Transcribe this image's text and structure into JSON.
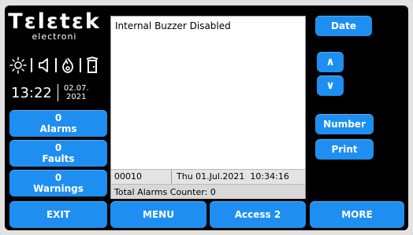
{
  "logo": {
    "name": "Tεlεtεk",
    "sub": "electroni"
  },
  "status_icons": [
    "sun-icon",
    "speaker-icon",
    "fire-icon",
    "door-icon"
  ],
  "clock": {
    "time": "13:22",
    "date_line1": "02.07.",
    "date_line2": "2021"
  },
  "left_buttons": [
    {
      "count": "0",
      "label": "Alarms"
    },
    {
      "count": "0",
      "label": "Faults"
    },
    {
      "count": "0",
      "label": "Warnings"
    }
  ],
  "screen": {
    "message": "Internal Buzzer Disabled",
    "event_number": "00010",
    "event_datetime": "Thu 01.Jul.2021  10:34:16",
    "counter_text": "Total Alarms Counter: 0"
  },
  "right_buttons": {
    "date": "Date",
    "up": "∧",
    "down": "∨",
    "number": "Number",
    "print": "Print"
  },
  "bottom_buttons": {
    "exit": "EXIT",
    "menu": "MENU",
    "access": "Access 2",
    "more": "MORE"
  },
  "colors": {
    "button": "#1e8ff0",
    "background": "#000000",
    "screen": "#ffffff"
  }
}
